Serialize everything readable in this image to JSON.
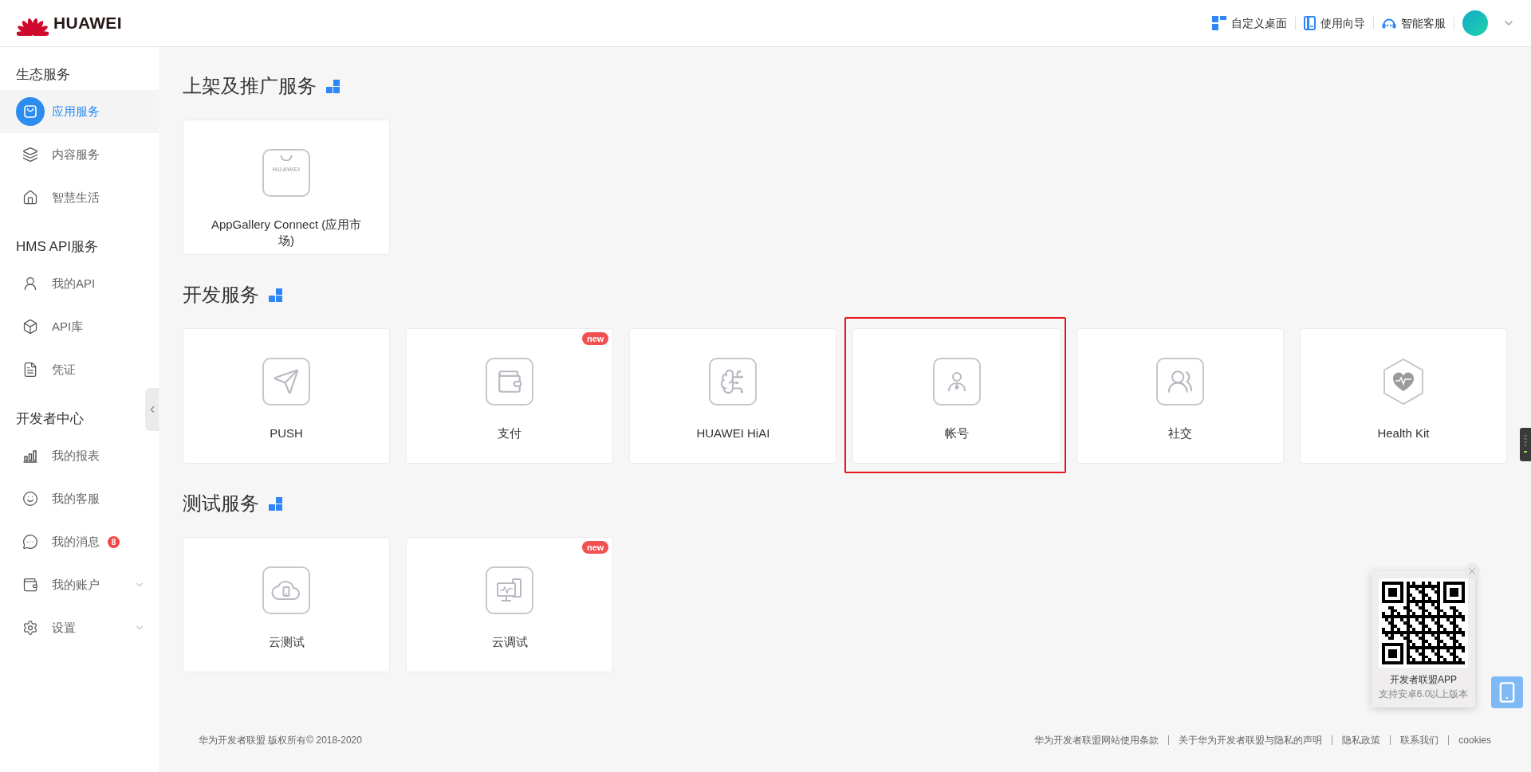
{
  "header": {
    "brand": "HUAWEI",
    "links": [
      {
        "label": "自定义桌面"
      },
      {
        "label": "使用向导"
      },
      {
        "label": "智能客服"
      }
    ]
  },
  "sidebar": {
    "sections": [
      {
        "title": "生态服务",
        "items": [
          {
            "label": "应用服务",
            "selected": true
          },
          {
            "label": "内容服务",
            "selected": false
          },
          {
            "label": "智慧生活",
            "selected": false
          }
        ]
      },
      {
        "title": "HMS API服务",
        "items": [
          {
            "label": "我的API",
            "selected": false
          },
          {
            "label": "API库",
            "selected": false
          },
          {
            "label": "凭证",
            "selected": false
          }
        ]
      },
      {
        "title": "开发者中心",
        "items": [
          {
            "label": "我的报表",
            "selected": false
          },
          {
            "label": "我的客服",
            "selected": false
          },
          {
            "label": "我的消息",
            "selected": false,
            "badge": "8"
          },
          {
            "label": "我的账户",
            "selected": false,
            "expanded": false
          },
          {
            "label": "设置",
            "selected": false,
            "expanded": false
          }
        ]
      }
    ]
  },
  "sections": [
    {
      "title": "上架及推广服务",
      "cards": [
        {
          "label": "AppGallery Connect (应用市场)",
          "icon_text": "HUAWEI",
          "highlighted": false
        }
      ]
    },
    {
      "title": "开发服务",
      "cards": [
        {
          "label": "PUSH",
          "highlighted": false
        },
        {
          "label": "支付",
          "badge": "new",
          "highlighted": false
        },
        {
          "label": "HUAWEI HiAI",
          "highlighted": false
        },
        {
          "label": "帐号",
          "highlighted": true
        },
        {
          "label": "社交",
          "highlighted": false
        },
        {
          "label": "Health Kit",
          "highlighted": false
        }
      ]
    },
    {
      "title": "测试服务",
      "cards": [
        {
          "label": "云测试",
          "highlighted": false
        },
        {
          "label": "云调试",
          "badge": "new",
          "highlighted": false
        }
      ]
    }
  ],
  "app_popup": {
    "title": "开发者联盟APP",
    "subtitle": "支持安卓6.0以上版本"
  },
  "footer": {
    "copyright": "华为开发者联盟 版权所有© 2018-2020",
    "links": [
      "华为开发者联盟网站使用条款",
      "关于华为开发者联盟与隐私的声明",
      "隐私政策",
      "联系我们",
      "cookies"
    ]
  }
}
